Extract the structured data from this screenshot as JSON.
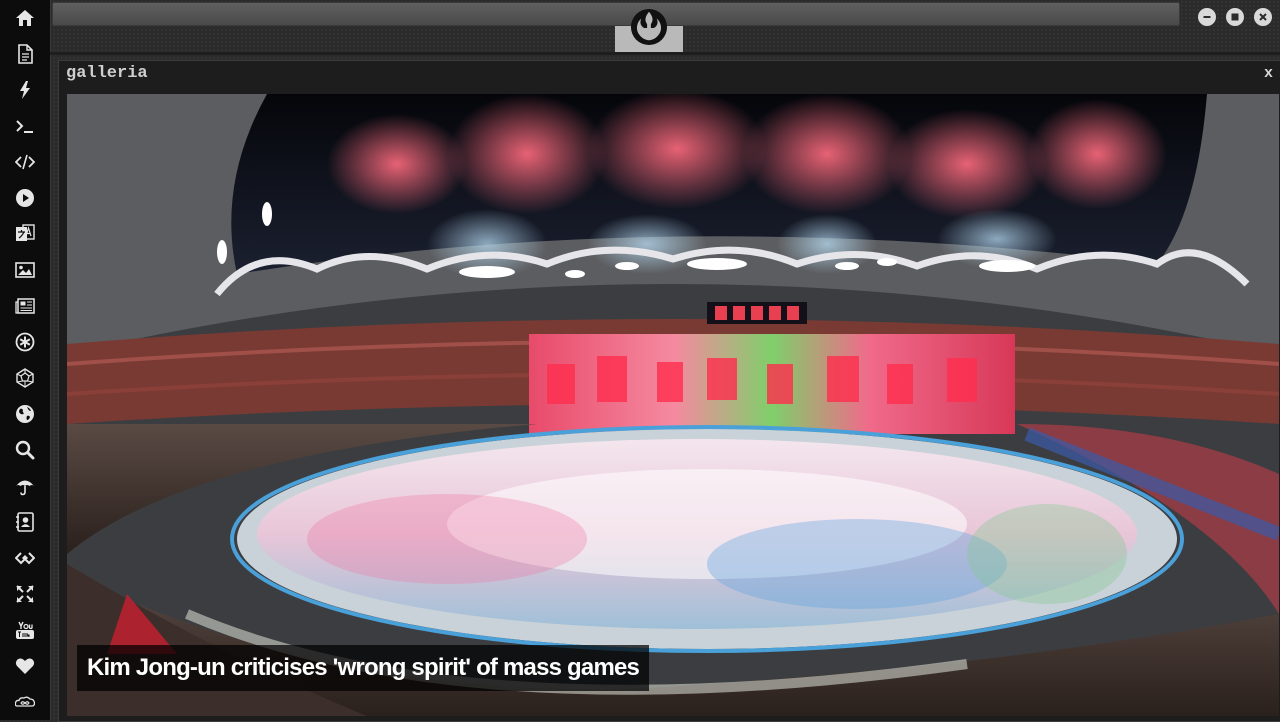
{
  "sidebar": {
    "items": [
      {
        "icon": "home-icon"
      },
      {
        "icon": "document-icon"
      },
      {
        "icon": "lightning-icon"
      },
      {
        "icon": "terminal-icon"
      },
      {
        "icon": "code-icon"
      },
      {
        "icon": "play-icon"
      },
      {
        "icon": "translate-icon"
      },
      {
        "icon": "image-icon"
      },
      {
        "icon": "newspaper-icon"
      },
      {
        "icon": "asterisk-circle-icon"
      },
      {
        "icon": "dodecahedron-icon"
      },
      {
        "icon": "globe-icon"
      },
      {
        "icon": "search-icon"
      },
      {
        "icon": "umbrella-icon"
      },
      {
        "icon": "contact-book-icon"
      },
      {
        "icon": "api-link-icon"
      },
      {
        "icon": "expand-icon"
      },
      {
        "icon": "youtube-icon"
      },
      {
        "icon": "heart-icon"
      },
      {
        "icon": "infinity-cloud-icon"
      }
    ]
  },
  "topbar": {
    "emblem": "rebel-alliance-emblem-icon",
    "controls": [
      "minimize-icon",
      "maximize-icon",
      "close-icon"
    ]
  },
  "gallery": {
    "title": "galleria",
    "close_label": "x",
    "caption": "Kim Jong-un criticises 'wrong spirit' of mass games"
  },
  "colors": {
    "sidebar_bg": "#0c0c0c",
    "desktop_bg": "#2b2b2b",
    "window_bg": "#1d1d1d",
    "caption_bg": "#000000b8"
  }
}
